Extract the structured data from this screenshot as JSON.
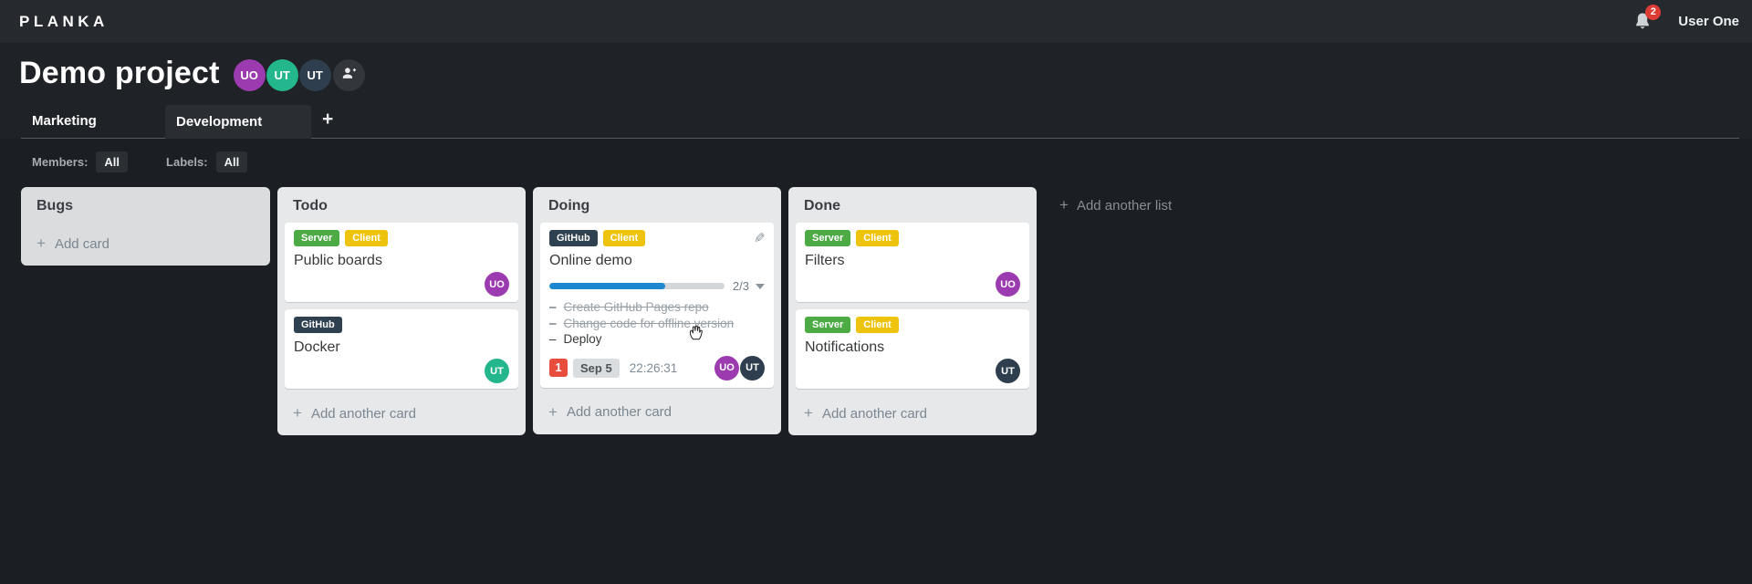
{
  "topbar": {
    "logo": "PLANKA",
    "notifications_count": "2",
    "user_name": "User One"
  },
  "project": {
    "title": "Demo project",
    "members": [
      {
        "initials": "UO",
        "color": "#9c3bb0"
      },
      {
        "initials": "UT",
        "color": "#24b68c"
      },
      {
        "initials": "UT",
        "color": "#2e3e4e"
      }
    ]
  },
  "tabs": {
    "items": [
      {
        "label": "Marketing"
      },
      {
        "label": "Development"
      }
    ]
  },
  "filters": {
    "members_label": "Members:",
    "members_value": "All",
    "labels_label": "Labels:",
    "labels_value": "All"
  },
  "icons": {
    "plus": "+",
    "pencil": "✎"
  },
  "colors": {
    "label_green": "#4cab44",
    "label_yellow": "#eec30e",
    "label_dark": "#2f4050",
    "avatar_purple": "#9c3bb0",
    "avatar_teal": "#24b68c",
    "avatar_navy": "#2e3e4e",
    "progress_blue": "#1d87cf",
    "badge_red": "#e74c3c"
  },
  "board": {
    "add_list_label": "Add another list",
    "lists": [
      {
        "name": "Bugs",
        "add_label": "Add card",
        "cards": []
      },
      {
        "name": "Todo",
        "add_label": "Add another card",
        "cards": [
          {
            "title": "Public boards",
            "labels": [
              {
                "name": "Server",
                "color": "#4cab44"
              },
              {
                "name": "Client",
                "color": "#eec30e"
              }
            ],
            "members": [
              {
                "initials": "UO",
                "color": "#9c3bb0"
              }
            ]
          },
          {
            "title": "Docker",
            "labels": [
              {
                "name": "GitHub",
                "color": "#2f4050"
              }
            ],
            "members": [
              {
                "initials": "UT",
                "color": "#24b68c"
              }
            ]
          }
        ]
      },
      {
        "name": "Doing",
        "add_label": "Add another card",
        "cards": [
          {
            "title": "Online demo",
            "labels": [
              {
                "name": "GitHub",
                "color": "#2f4050"
              },
              {
                "name": "Client",
                "color": "#eec30e"
              }
            ],
            "progress": {
              "label": "2/3",
              "fill": "66%"
            },
            "tasks": [
              {
                "text": "Create GitHub Pages repo",
                "done": true
              },
              {
                "text": "Change code for offline version",
                "done": true
              },
              {
                "text": "Deploy",
                "done": false
              }
            ],
            "footer": {
              "notifications": "1",
              "due_date": "Sep 5",
              "timer": "22:26:31"
            },
            "members": [
              {
                "initials": "UO",
                "color": "#9c3bb0"
              },
              {
                "initials": "UT",
                "color": "#2e3e4e"
              }
            ]
          }
        ]
      },
      {
        "name": "Done",
        "add_label": "Add another card",
        "cards": [
          {
            "title": "Filters",
            "labels": [
              {
                "name": "Server",
                "color": "#4cab44"
              },
              {
                "name": "Client",
                "color": "#eec30e"
              }
            ],
            "members": [
              {
                "initials": "UO",
                "color": "#9c3bb0"
              }
            ]
          },
          {
            "title": "Notifications",
            "labels": [
              {
                "name": "Server",
                "color": "#4cab44"
              },
              {
                "name": "Client",
                "color": "#eec30e"
              }
            ],
            "members": [
              {
                "initials": "UT",
                "color": "#2e3e4e"
              }
            ]
          }
        ]
      }
    ]
  },
  "tasks_dash": "–"
}
